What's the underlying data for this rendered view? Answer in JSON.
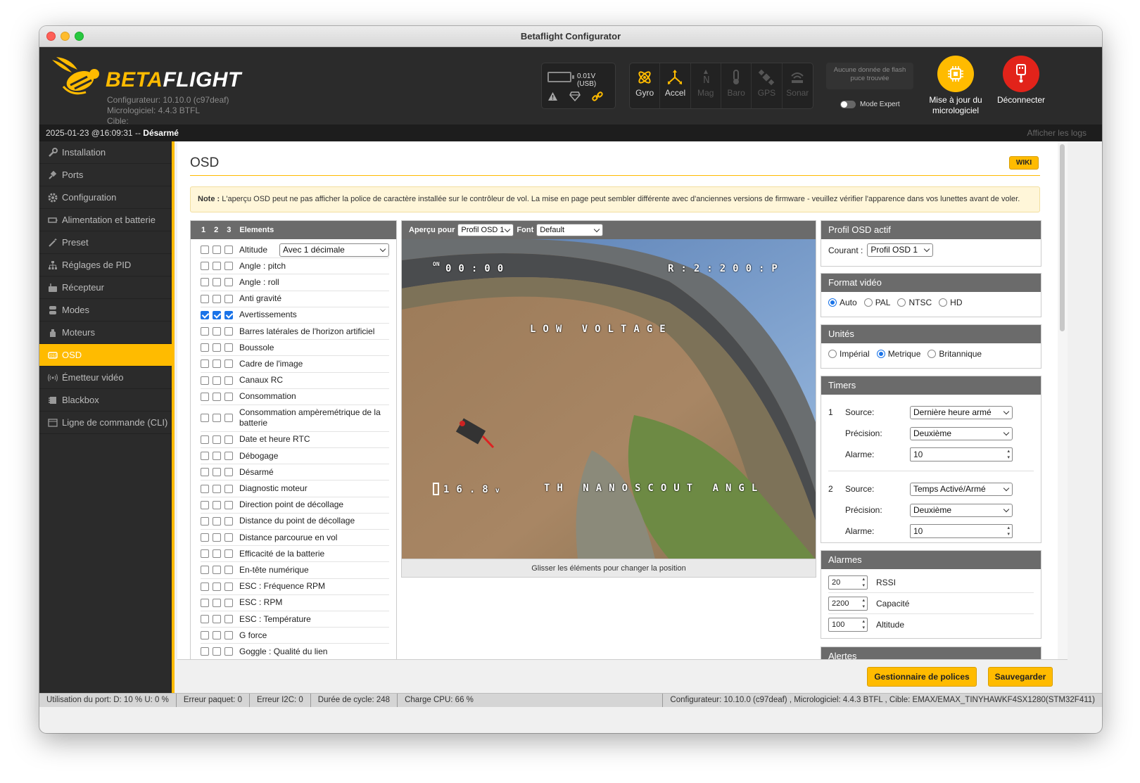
{
  "window": {
    "title": "Betaflight Configurator"
  },
  "header": {
    "logo_part1": "BETA",
    "logo_part2": "FLIGHT",
    "configurator_version": "Configurateur: 10.10.0 (c97deaf)",
    "firmware_version": "Micrologiciel: 4.4.3 BTFL",
    "target": "Cible: EMAX/EMAX_TINYHAWKF4SX1280(STM32F411)",
    "battery_label": "0.01V (USB)",
    "sensors": [
      {
        "label": "Gyro",
        "active": true,
        "icon": "gyro-icon"
      },
      {
        "label": "Accel",
        "active": true,
        "icon": "accel-icon"
      },
      {
        "label": "Mag",
        "active": false,
        "icon": "mag-icon"
      },
      {
        "label": "Baro",
        "active": false,
        "icon": "baro-icon"
      },
      {
        "label": "GPS",
        "active": false,
        "icon": "gps-icon"
      },
      {
        "label": "Sonar",
        "active": false,
        "icon": "sonar-icon"
      }
    ],
    "flash_info": "Aucune donnée de flash puce trouvée",
    "expert_mode": "Mode Expert",
    "update_firmware": "Mise à jour du micrologiciel",
    "disconnect": "Déconnecter",
    "accent_color": "#ffbb00",
    "disconnect_color": "#e2231a"
  },
  "status_top": {
    "datetime": "2025-01-23 @16:09:31 -- ",
    "armed": "Désarmé",
    "show_logs": "Afficher les logs"
  },
  "sidebar": {
    "items": [
      {
        "label": "Installation",
        "icon": "wrench-icon"
      },
      {
        "label": "Ports",
        "icon": "plug-icon"
      },
      {
        "label": "Configuration",
        "icon": "gear-icon"
      },
      {
        "label": "Alimentation et batterie",
        "icon": "battery-icon"
      },
      {
        "label": "Preset",
        "icon": "wand-icon"
      },
      {
        "label": "Réglages de PID",
        "icon": "sitemap-icon"
      },
      {
        "label": "Récepteur",
        "icon": "receiver-icon"
      },
      {
        "label": "Modes",
        "icon": "modes-icon"
      },
      {
        "label": "Moteurs",
        "icon": "motor-icon"
      },
      {
        "label": "OSD",
        "icon": "osd-icon",
        "active": true
      },
      {
        "label": "Émetteur vidéo",
        "icon": "broadcast-icon"
      },
      {
        "label": "Blackbox",
        "icon": "blackbox-icon"
      },
      {
        "label": "Ligne de commande (CLI)",
        "icon": "terminal-icon"
      }
    ]
  },
  "page": {
    "title": "OSD",
    "wiki": "WIKI",
    "note_label": "Note :",
    "note_text": "L'aperçu OSD peut ne pas afficher la police de caractère installée sur le contrôleur de vol. La mise en page peut sembler différente avec d'anciennes versions de firmware - veuillez vérifier l'apparence dans vos lunettes avant de voler."
  },
  "elements": {
    "profiles": [
      "1",
      "2",
      "3"
    ],
    "header": "Elements",
    "altitude_option": "Avec 1 décimale",
    "items": [
      {
        "name": "Altitude",
        "checked": [
          false,
          false,
          false
        ]
      },
      {
        "name": "Angle : pitch",
        "checked": [
          false,
          false,
          false
        ]
      },
      {
        "name": "Angle : roll",
        "checked": [
          false,
          false,
          false
        ]
      },
      {
        "name": "Anti gravité",
        "checked": [
          false,
          false,
          false
        ]
      },
      {
        "name": "Avertissements",
        "checked": [
          true,
          true,
          true
        ]
      },
      {
        "name": "Barres latérales de l'horizon artificiel",
        "checked": [
          false,
          false,
          false
        ]
      },
      {
        "name": "Boussole",
        "checked": [
          false,
          false,
          false
        ]
      },
      {
        "name": "Cadre de l'image",
        "checked": [
          false,
          false,
          false
        ]
      },
      {
        "name": "Canaux RC",
        "checked": [
          false,
          false,
          false
        ]
      },
      {
        "name": "Consommation",
        "checked": [
          false,
          false,
          false
        ]
      },
      {
        "name": "Consommation ampèremétrique de la batterie",
        "checked": [
          false,
          false,
          false
        ]
      },
      {
        "name": "Date et heure RTC",
        "checked": [
          false,
          false,
          false
        ]
      },
      {
        "name": "Débogage",
        "checked": [
          false,
          false,
          false
        ]
      },
      {
        "name": "Désarmé",
        "checked": [
          false,
          false,
          false
        ]
      },
      {
        "name": "Diagnostic moteur",
        "checked": [
          false,
          false,
          false
        ]
      },
      {
        "name": "Direction point de décollage",
        "checked": [
          false,
          false,
          false
        ]
      },
      {
        "name": "Distance du point de décollage",
        "checked": [
          false,
          false,
          false
        ]
      },
      {
        "name": "Distance parcourue en vol",
        "checked": [
          false,
          false,
          false
        ]
      },
      {
        "name": "Efficacité de la batterie",
        "checked": [
          false,
          false,
          false
        ]
      },
      {
        "name": "En-tête numérique",
        "checked": [
          false,
          false,
          false
        ]
      },
      {
        "name": "ESC : Fréquence RPM",
        "checked": [
          false,
          false,
          false
        ]
      },
      {
        "name": "ESC : RPM",
        "checked": [
          false,
          false,
          false
        ]
      },
      {
        "name": "ESC : Température",
        "checked": [
          false,
          false,
          false
        ]
      },
      {
        "name": "G force",
        "checked": [
          false,
          false,
          false
        ]
      },
      {
        "name": "Goggle : Qualité du lien",
        "checked": [
          false,
          false,
          false
        ]
      }
    ]
  },
  "preview": {
    "label": "Aperçu pour",
    "profile": "Profil OSD 1",
    "font_label": "Font",
    "font": "Default",
    "footer": "Glisser les éléments pour changer la position",
    "osd_timer": "00:00",
    "osd_timer_prefix": "ON",
    "osd_rssi": "R:2:200:P",
    "osd_warning": "LOW VOLTAGE",
    "osd_voltage": "16.8",
    "osd_voltage_unit": "v",
    "osd_craft": "TH NANOSCOUT ANGL"
  },
  "profile_active": {
    "title": "Profil OSD actif",
    "label": "Courant :",
    "value": "Profil OSD 1"
  },
  "video_format": {
    "title": "Format vidéo",
    "options": [
      "Auto",
      "PAL",
      "NTSC",
      "HD"
    ],
    "selected": "Auto"
  },
  "units": {
    "title": "Unités",
    "options": [
      "Impérial",
      "Metrique",
      "Britannique"
    ],
    "selected": "Metrique"
  },
  "timers": {
    "title": "Timers",
    "items": [
      {
        "num": "1",
        "source_label": "Source:",
        "source": "Dernière heure armé",
        "precision_label": "Précision:",
        "precision": "Deuxième",
        "alarm_label": "Alarme:",
        "alarm": "10"
      },
      {
        "num": "2",
        "source_label": "Source:",
        "source": "Temps Activé/Armé",
        "precision_label": "Précision:",
        "precision": "Deuxième",
        "alarm_label": "Alarme:",
        "alarm": "10"
      }
    ]
  },
  "alarms": {
    "title": "Alarmes",
    "items": [
      {
        "value": "20",
        "label": "RSSI"
      },
      {
        "value": "2200",
        "label": "Capacité"
      },
      {
        "value": "100",
        "label": "Altitude"
      }
    ]
  },
  "alerts": {
    "title": "Alertes"
  },
  "buttons": {
    "font_manager": "Gestionnaire de polices",
    "save": "Sauvegarder"
  },
  "footer": {
    "port": "Utilisation du port: D: 10 % U: 0 %",
    "packet": "Erreur paquet: 0",
    "i2c": "Erreur I2C: 0",
    "cycle": "Durée de cycle: 248",
    "cpu": "Charge CPU: 66 %",
    "info": "Configurateur: 10.10.0 (c97deaf) , Micrologiciel: 4.4.3 BTFL , Cible: EMAX/EMAX_TINYHAWKF4SX1280(STM32F411)"
  }
}
